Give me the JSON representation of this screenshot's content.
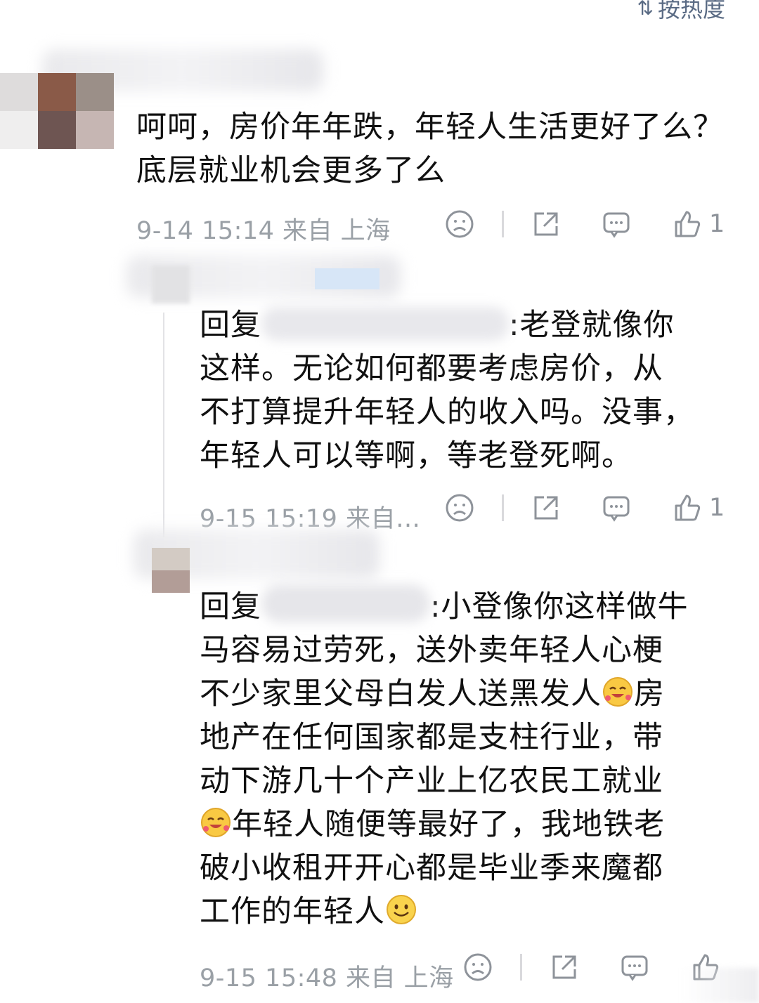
{
  "sort": {
    "label": "按热度"
  },
  "comments": [
    {
      "text_line1": "呵呵，房价年年跌，年轻人生活更好了么？",
      "text_line2": "底层就业机会更多了么",
      "meta": "9-14 15:14 来自 上海",
      "like_count": "1"
    },
    {
      "reply_prefix": "回复",
      "line1_suffix": ":老登就像你",
      "line2": "这样。无论如何都要考虑房价，从",
      "line3": "不打算提升年轻人的收入吗。没事，",
      "line4": "年轻人可以等啊，等老登死啊。",
      "meta": "9-15 15:19 来自…",
      "like_count": "1"
    },
    {
      "reply_prefix": "回复",
      "line1_suffix": ":小登像你这样做牛",
      "line2": "马容易过劳死，送外卖年轻人心梗",
      "line3a": "不少家里父母白发人送黑发人",
      "line3b": "房",
      "line4": "地产在任何国家都是支柱行业，带",
      "line5": "动下游几十个产业上亿农民工就业",
      "line6": "年轻人随便等最好了，我地铁老",
      "line7": "破小收租开开心都是毕业季来魔都",
      "line8": "工作的年轻人",
      "meta": "9-15 15:48 来自 上海"
    }
  ],
  "icons": {
    "sort": "sort-arrows-icon",
    "dislike": "sad-face-icon",
    "share": "share-icon",
    "comment": "comment-bubble-icon",
    "like": "thumbs-up-icon",
    "emoji_laugh": "laughing-hearts-emoji",
    "emoji_smile": "smile-emoji"
  },
  "colors": {
    "meta": "#9aa0a6",
    "sort": "#5a6b84",
    "icon": "#8e939a"
  }
}
